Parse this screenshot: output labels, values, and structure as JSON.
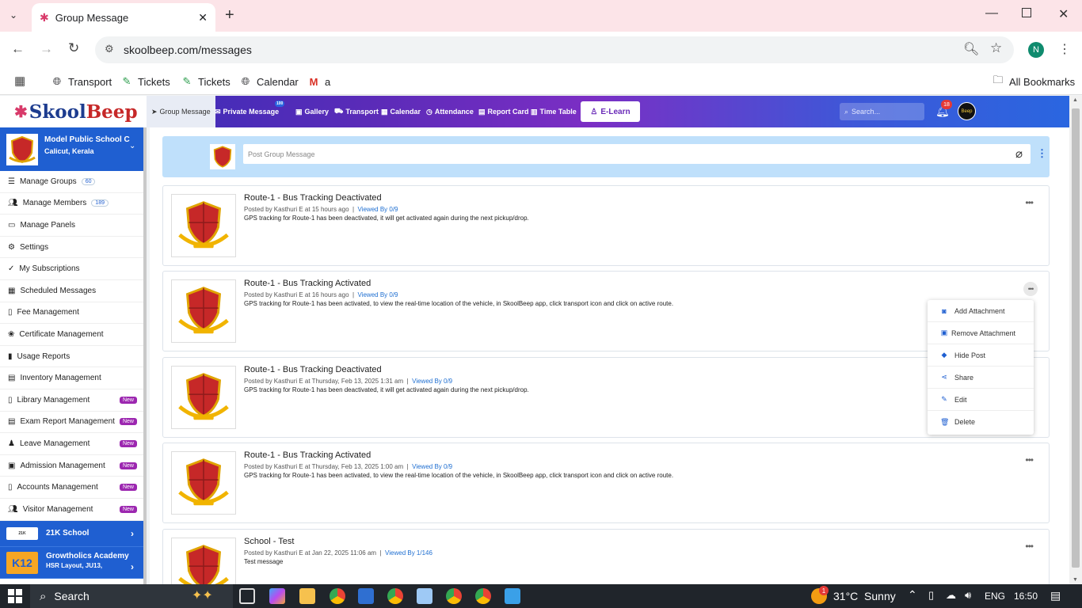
{
  "browser": {
    "tab_title": "Group Message",
    "url": "skoolbeep.com/messages",
    "profile_initial": "N",
    "bookmarks": [
      "Transport",
      "Tickets",
      "Tickets",
      "Calendar",
      "a"
    ],
    "all_bookmarks": "All Bookmarks"
  },
  "app": {
    "logo_a": "Skool",
    "logo_b": "Beep",
    "nav": {
      "group_message": "Group Message",
      "private_message": "Private Message",
      "private_badge": "100",
      "gallery": "Gallery",
      "transport": "Transport",
      "calendar": "Calendar",
      "attendance": "Attendance",
      "report_card": "Report Card",
      "time_table": "Time Table",
      "elearn": "E-Learn"
    },
    "search_placeholder": "Search...",
    "notif_count": "18",
    "avatar_text": "Beep"
  },
  "sidebar": {
    "school_name": "Model Public School C",
    "school_loc": "Calicut, Kerala",
    "items": [
      {
        "label": "Manage Groups",
        "count": "60"
      },
      {
        "label": "Manage Members",
        "count": "189"
      },
      {
        "label": "Manage Panels"
      },
      {
        "label": "Settings"
      },
      {
        "label": "My Subscriptions"
      },
      {
        "label": "Scheduled Messages"
      },
      {
        "label": "Fee Management"
      },
      {
        "label": "Certificate Management"
      },
      {
        "label": "Usage Reports"
      },
      {
        "label": "Inventory Management"
      },
      {
        "label": "Library Management",
        "badge": "New"
      },
      {
        "label": "Exam Report Management",
        "badge": "New"
      },
      {
        "label": "Leave Management",
        "badge": "New"
      },
      {
        "label": "Admission Management",
        "badge": "New"
      },
      {
        "label": "Accounts Management",
        "badge": "New"
      },
      {
        "label": "Visitor Management",
        "badge": "New"
      }
    ],
    "orgs": [
      {
        "name": "21K School",
        "sub": ""
      },
      {
        "name": "Growtholics Academy",
        "sub": "HSR Layout, JU13,"
      }
    ]
  },
  "composer": {
    "placeholder": "Post Group Message"
  },
  "posts": [
    {
      "title": "Route-1 - Bus Tracking Deactivated",
      "meta": "Posted by Kasthuri E at 15 hours ago",
      "viewed": "Viewed By 0/9",
      "body": "GPS tracking for Route-1 has been deactivated, it will get activated again during the next pickup/drop."
    },
    {
      "title": "Route-1 - Bus Tracking Activated",
      "meta": "Posted by Kasthuri E at 16 hours ago",
      "viewed": "Viewed By 0/9",
      "body": "GPS tracking for Route-1 has been activated, to view the real-time location of the vehicle, in SkoolBeep app, click transport icon and click on active route."
    },
    {
      "title": "Route-1 - Bus Tracking Deactivated",
      "meta": "Posted by Kasthuri E at Thursday, Feb 13, 2025 1:31 am",
      "viewed": "Viewed By 0/9",
      "body": "GPS tracking for Route-1 has been deactivated, it will get activated again during the next pickup/drop."
    },
    {
      "title": "Route-1 - Bus Tracking Activated",
      "meta": "Posted by Kasthuri E at Thursday, Feb 13, 2025 1:00 am",
      "viewed": "Viewed By 0/9",
      "body": "GPS tracking for Route-1 has been activated, to view the real-time location of the vehicle, in SkoolBeep app, click transport icon and click on active route."
    },
    {
      "title": "School - Test",
      "meta": "Posted by Kasthuri E at Jan 22, 2025 11:06 am",
      "viewed": "Viewed By 1/146",
      "body": "Test message"
    }
  ],
  "context_menu": [
    "Add Attachment",
    "Remove Attachment",
    "Hide Post",
    "Share",
    "Edit",
    "Delete"
  ],
  "taskbar": {
    "search": "Search",
    "weather": "31°C  Sunny",
    "weather_badge": "1",
    "lang": "ENG",
    "time": "16:50"
  },
  "colors": {
    "brand_blue": "#1f5fd1",
    "accent_purple": "#7b2ec4",
    "new_badge": "#9c27b0"
  }
}
